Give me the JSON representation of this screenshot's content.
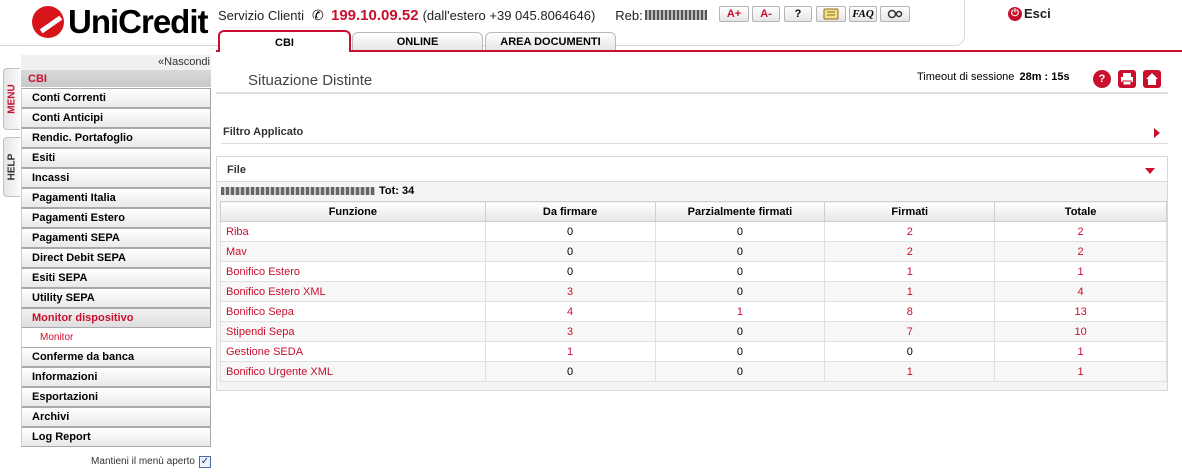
{
  "header": {
    "brand": "UniCredit",
    "service_label": "Servizio Clienti",
    "phone_number": "199.10.09.52",
    "phone_abroad": "(dall'estero +39 045.8064646)",
    "reb_label": "Reb:",
    "buttons": {
      "font_up": "A+",
      "font_down": "A-",
      "help": "?",
      "faq": "FAQ"
    },
    "logout_label": "Esci",
    "tabs": [
      {
        "label": "CBI"
      },
      {
        "label": "ONLINE"
      },
      {
        "label": "AREA DOCUMENTI"
      }
    ]
  },
  "side_tabs": {
    "menu": "MENU",
    "help": "HELP"
  },
  "sidebar": {
    "hide_label": "«Nascondi",
    "section_title": "CBI",
    "items": [
      {
        "label": "Conti Correnti"
      },
      {
        "label": "Conti Anticipi"
      },
      {
        "label": "Rendic. Portafoglio"
      },
      {
        "label": "Esiti"
      },
      {
        "label": "Incassi"
      },
      {
        "label": "Pagamenti Italia"
      },
      {
        "label": "Pagamenti Estero"
      },
      {
        "label": "Pagamenti SEPA"
      },
      {
        "label": "Direct Debit SEPA"
      },
      {
        "label": "Esiti SEPA"
      },
      {
        "label": "Utility SEPA"
      },
      {
        "label": "Monitor dispositivo"
      },
      {
        "label": "Monitor"
      },
      {
        "label": "Conferme da banca"
      },
      {
        "label": "Informazioni"
      },
      {
        "label": "Esportazioni"
      },
      {
        "label": "Archivi"
      },
      {
        "label": "Log Report"
      }
    ],
    "keep_open_label": "Mantieni il menù aperto",
    "keep_open_checked": true
  },
  "main": {
    "title": "Situazione Distinte",
    "timeout_label": "Timeout di sessione",
    "timeout_value": "28m : 15s",
    "filter_label": "Filtro Applicato",
    "file_label": "File",
    "file_total": "Tot: 34",
    "table": {
      "headers": [
        "Funzione",
        "Da firmare",
        "Parzialmente firmati",
        "Firmati",
        "Totale"
      ],
      "rows": [
        [
          "Riba",
          "0",
          "0",
          "2",
          "2"
        ],
        [
          "Mav",
          "0",
          "0",
          "2",
          "2"
        ],
        [
          "Bonifico Estero",
          "0",
          "0",
          "1",
          "1"
        ],
        [
          "Bonifico Estero XML",
          "3",
          "0",
          "1",
          "4"
        ],
        [
          "Bonifico Sepa",
          "4",
          "1",
          "8",
          "13"
        ],
        [
          "Stipendi Sepa",
          "3",
          "0",
          "7",
          "10"
        ],
        [
          "Gestione SEDA",
          "1",
          "0",
          "0",
          "1"
        ],
        [
          "Bonifico Urgente XML",
          "0",
          "0",
          "1",
          "1"
        ]
      ]
    }
  },
  "colors": {
    "accent": "#c8102e"
  }
}
